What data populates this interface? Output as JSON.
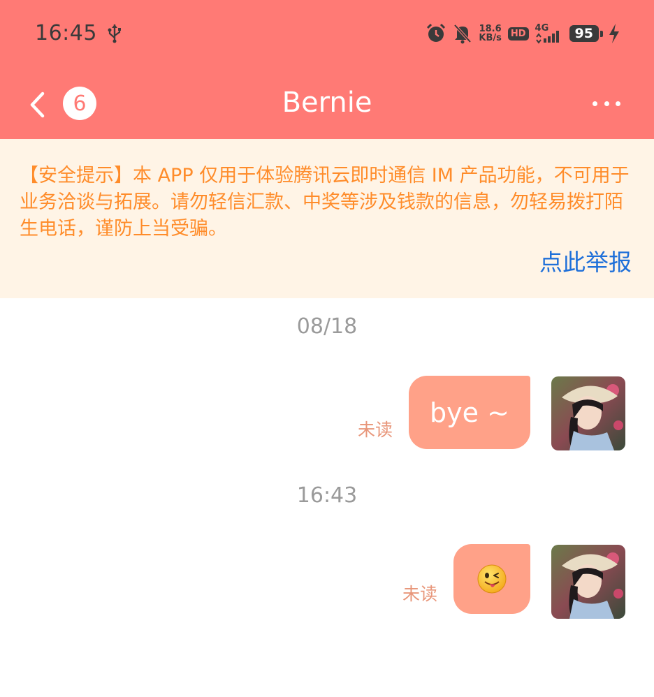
{
  "status_bar": {
    "time": "16:45",
    "net_speed_value": "18.6",
    "net_speed_unit": "KB/s",
    "hd_label": "HD",
    "network_label": "4G",
    "battery": "95",
    "icons": [
      "usb-icon",
      "alarm-icon",
      "mute-icon",
      "signal-icon",
      "charging-icon"
    ]
  },
  "header": {
    "back_icon": "chevron-left-icon",
    "unread_count": "6",
    "title": "Bernie",
    "more_icon": "more-horizontal-icon"
  },
  "notice": {
    "text": "【安全提示】本 APP 仅用于体验腾讯云即时通信 IM 产品功能，不可用于业务洽谈与拓展。请勿轻信汇款、中奖等涉及钱款的信息，勿轻易拨打陌生电话，谨防上当受骗。",
    "report_link": "点此举报"
  },
  "messages": [
    {
      "divider": "08/18",
      "text": "bye ~",
      "status": "未读"
    },
    {
      "divider": "16:43",
      "emoji": "😜",
      "emoji_icon": "wink-tongue-emoji-icon",
      "status": "未读"
    }
  ],
  "colors": {
    "header_bg": "#FF7A75",
    "notice_bg": "#FFF4E6",
    "notice_text": "#FF8C2A",
    "link": "#1E6FD9",
    "bubble": "#FFA188",
    "unread_label": "#E8967A"
  }
}
